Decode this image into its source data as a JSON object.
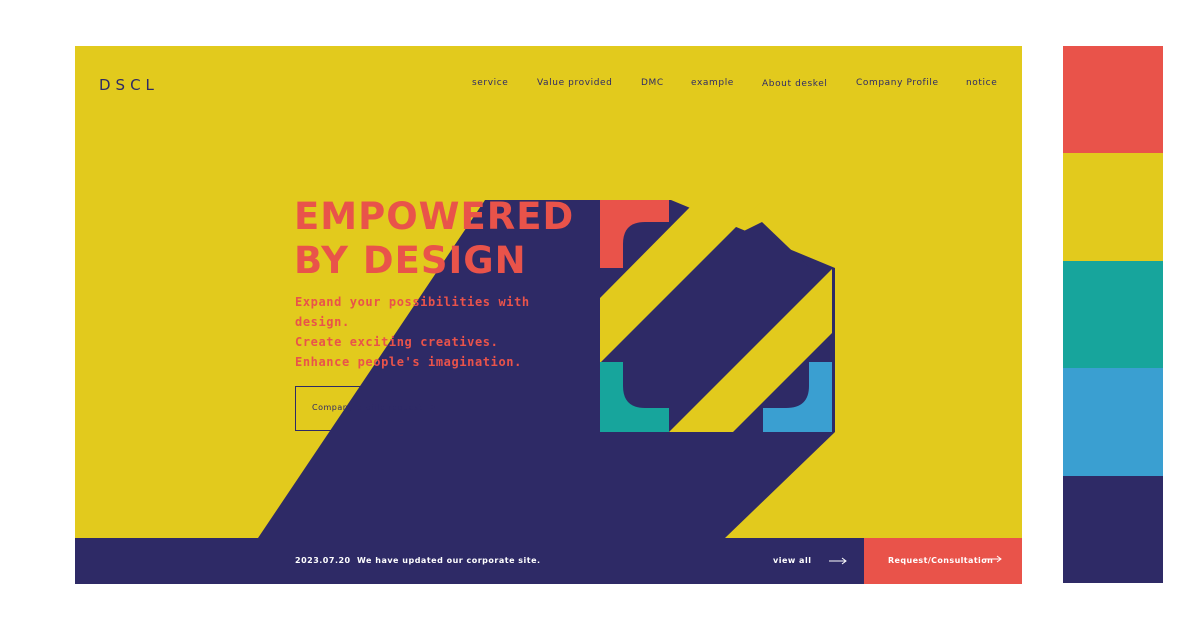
{
  "brand": {
    "logo_text": "DSCL"
  },
  "nav": {
    "items": [
      {
        "label": "service"
      },
      {
        "label": "Value provided"
      },
      {
        "label": "DMC"
      },
      {
        "label": "example"
      },
      {
        "label": "About deskel"
      },
      {
        "label": "Company Profile"
      },
      {
        "label": "notice"
      }
    ]
  },
  "hero": {
    "title_line1": "EMPOWERED",
    "title_line2": "BY DESIGN",
    "sub_line1": "Expand your possibilities with",
    "sub_line2": "design.",
    "sub_line3": "Create exciting creatives.",
    "sub_line4": "Enhance people's imagination.",
    "cta_label": "Company profile request"
  },
  "news": {
    "date": "2023.07.20",
    "text": "We have updated our corporate site.",
    "view_all": "view all",
    "request_label": "Request/Consultation"
  },
  "colors": {
    "background": "#E2CA1D",
    "navy": "#2E2A66",
    "coral": "#E9534A",
    "teal": "#17A59C",
    "sky": "#3A9FD1"
  },
  "palette": [
    "#E9534A",
    "#E2CA1D",
    "#17A59C",
    "#3A9FD1",
    "#2E2A66"
  ]
}
